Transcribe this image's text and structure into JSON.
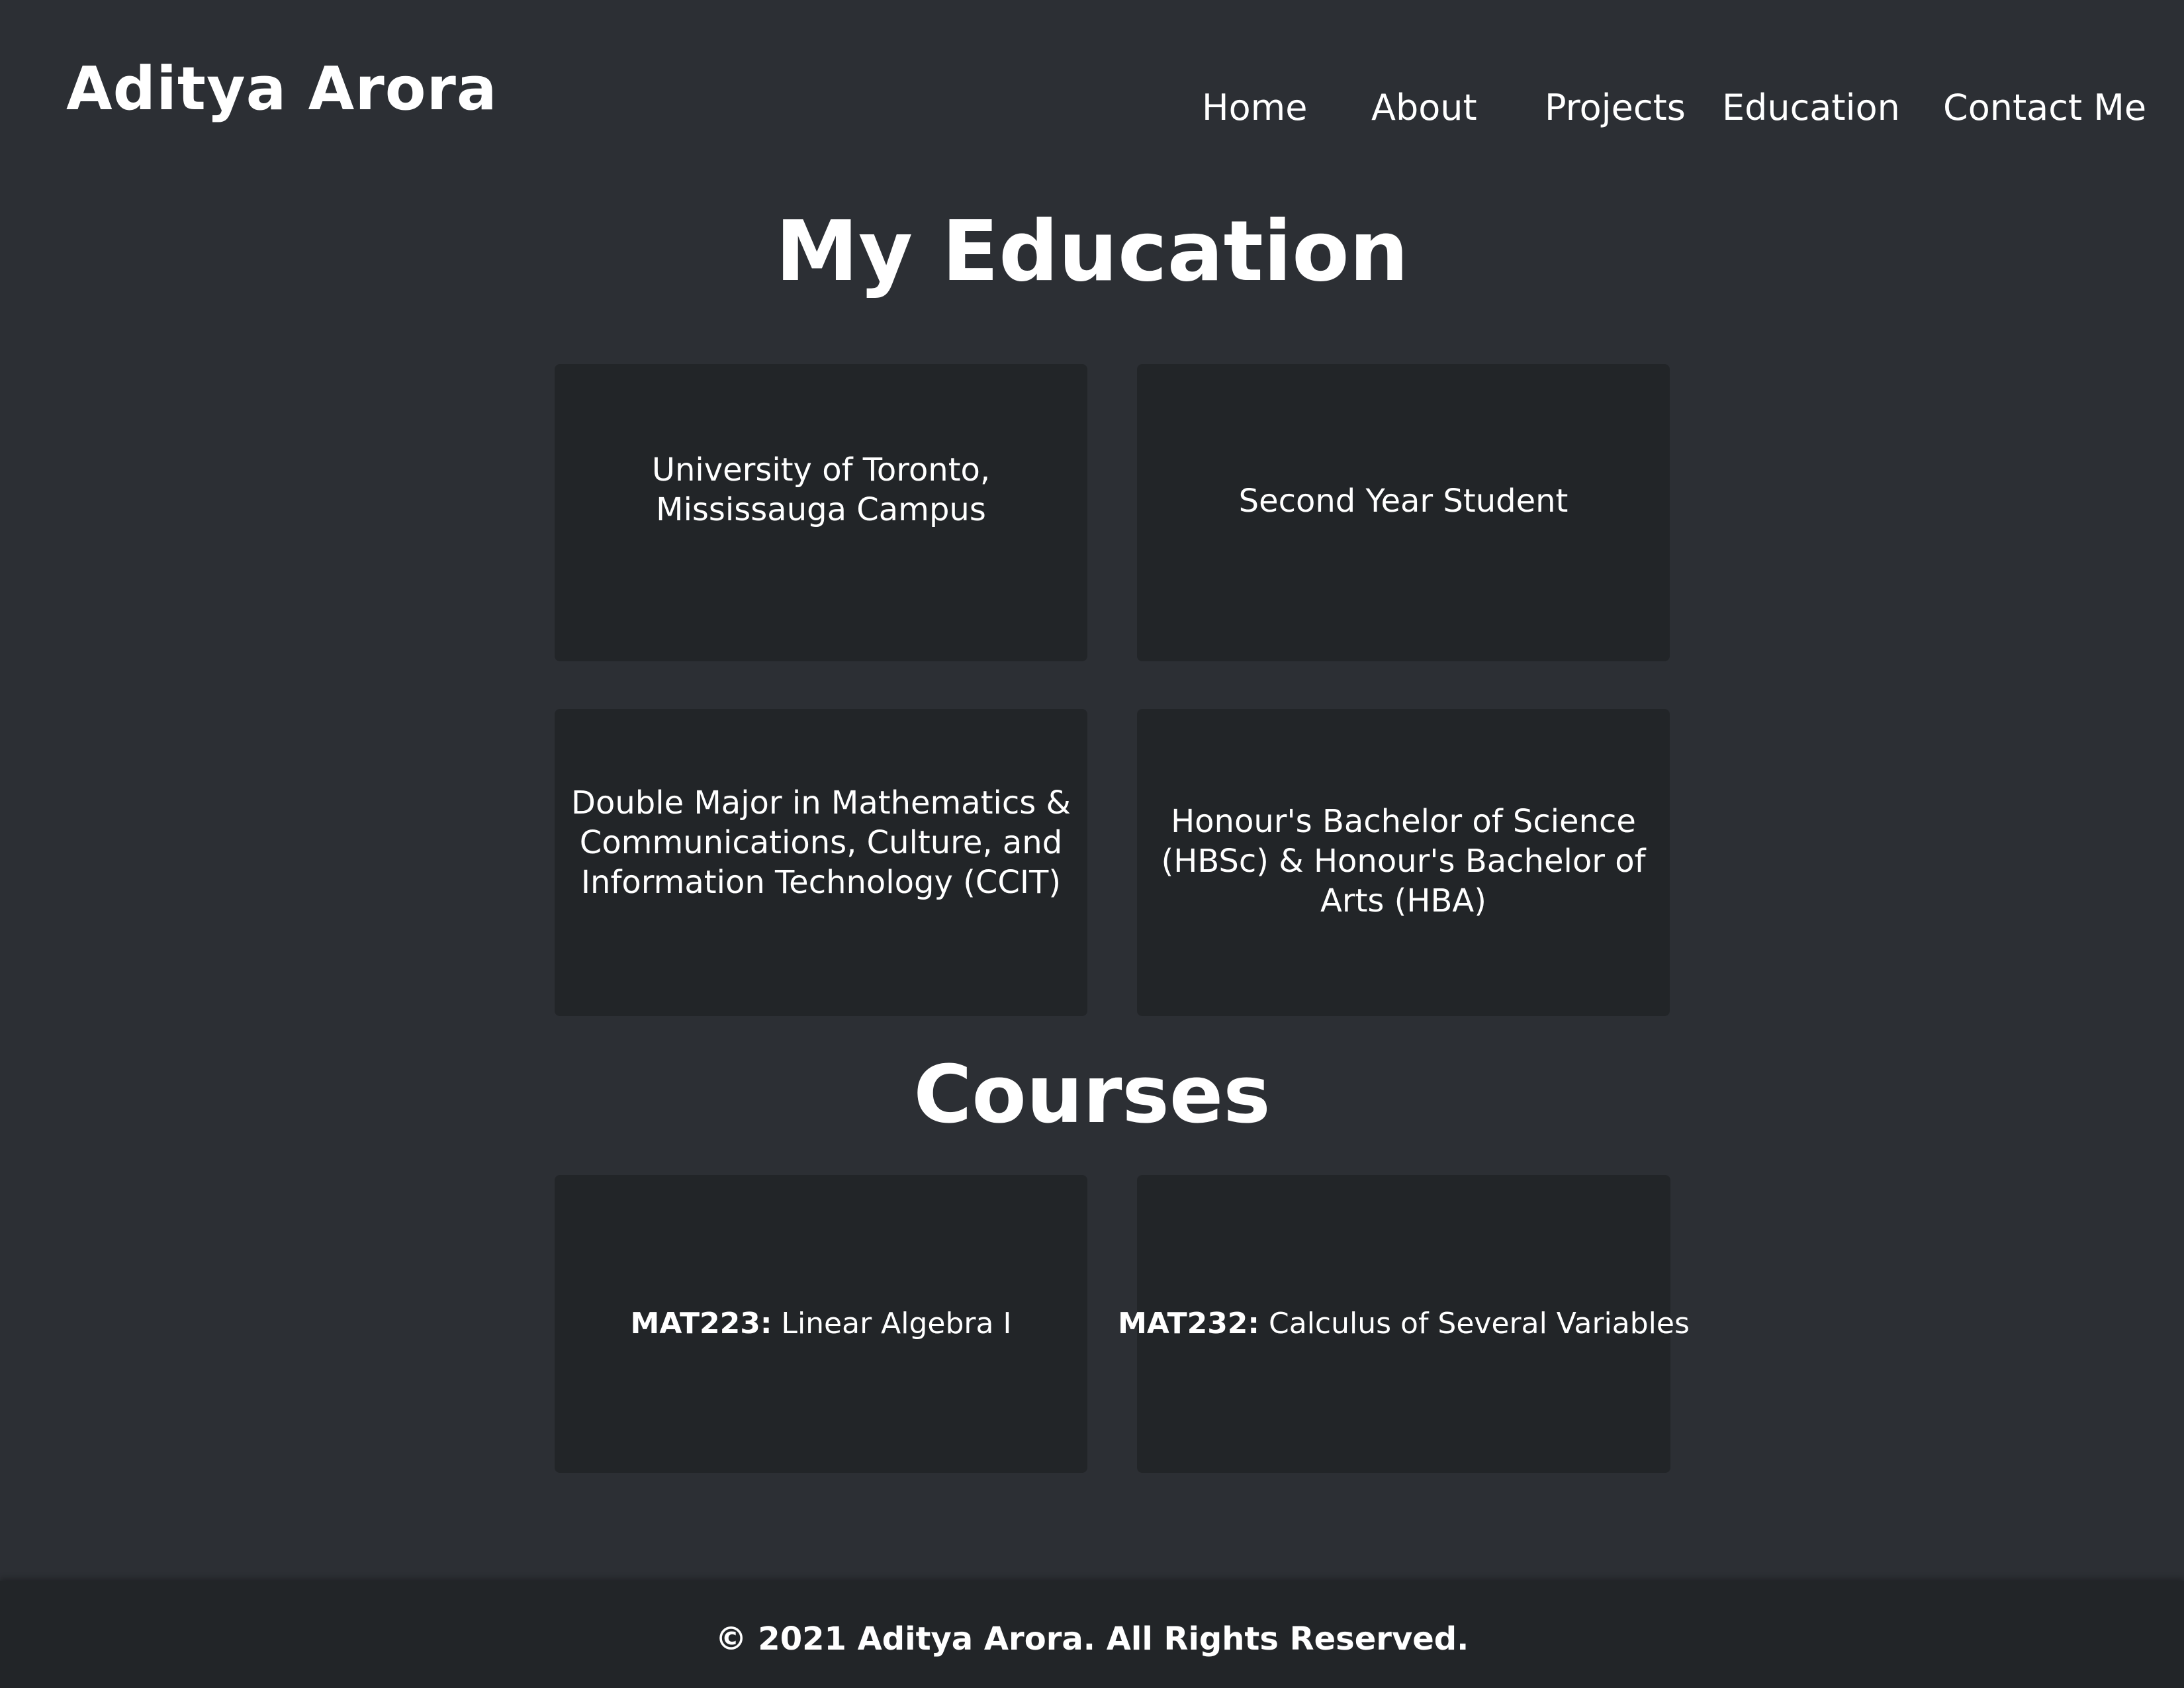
{
  "header": {
    "brand": "Aditya Arora",
    "nav": {
      "home": "Home",
      "about": "About",
      "projects": "Projects",
      "education": "Education",
      "contact": "Contact Me"
    }
  },
  "education": {
    "title": "My Education",
    "cards": [
      "University of Toronto, Mississauga Campus",
      "Second Year Student",
      "Double Major in Mathematics & Communications, Culture, and Information Technology (CCIT)",
      "Honour's Bachelor of Science (HBSc) & Honour's Bachelor of Arts (HBA)"
    ]
  },
  "courses": {
    "title": "Courses",
    "items": [
      {
        "code": "MAT223:",
        "name": " Linear Algebra I"
      },
      {
        "code": "MAT232:",
        "name": " Calculus of Several Variables"
      }
    ]
  },
  "footer": {
    "copyright": "© 2021 Aditya Arora. All Rights Reserved."
  },
  "colors": {
    "page_background": "#2c2f34",
    "card_background": "#222528",
    "footer_background": "#222528",
    "text": "#ffffff"
  }
}
